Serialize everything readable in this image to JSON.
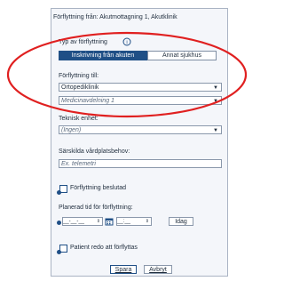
{
  "header": {
    "title": "Förflyttning från: Akutmottagning 1, Akutklinik"
  },
  "transfer_type": {
    "label": "Typ av förflyttning",
    "info_icon": "info-icon",
    "options": [
      {
        "label": "Inskrivning från akuten",
        "active": true
      },
      {
        "label": "Annat sjukhus",
        "active": false
      }
    ]
  },
  "transfer_to": {
    "label": "Förflyttning till:",
    "clinic": "Ortopediklinik",
    "department": "Medicinavdelning 1"
  },
  "technical_unit": {
    "label": "Teknisk enhet:",
    "value": "(Ingen)"
  },
  "special_needs": {
    "label": "Särskilda vårdplatsbehov:",
    "placeholder": "Ex. telemetri"
  },
  "transfer_decided": {
    "label": "Förflyttning beslutad"
  },
  "planned_time": {
    "label": "Planerad tid för förflyttning:",
    "date_placeholder": "__-__-__",
    "time_placeholder": "__:__",
    "today_label": "Idag"
  },
  "patient_ready": {
    "label": "Patient redo att förflyttas"
  },
  "actions": {
    "save": "Spara",
    "cancel": "Avbryt"
  },
  "colors": {
    "accent": "#1f4f86",
    "highlight_ring": "#e02020"
  }
}
